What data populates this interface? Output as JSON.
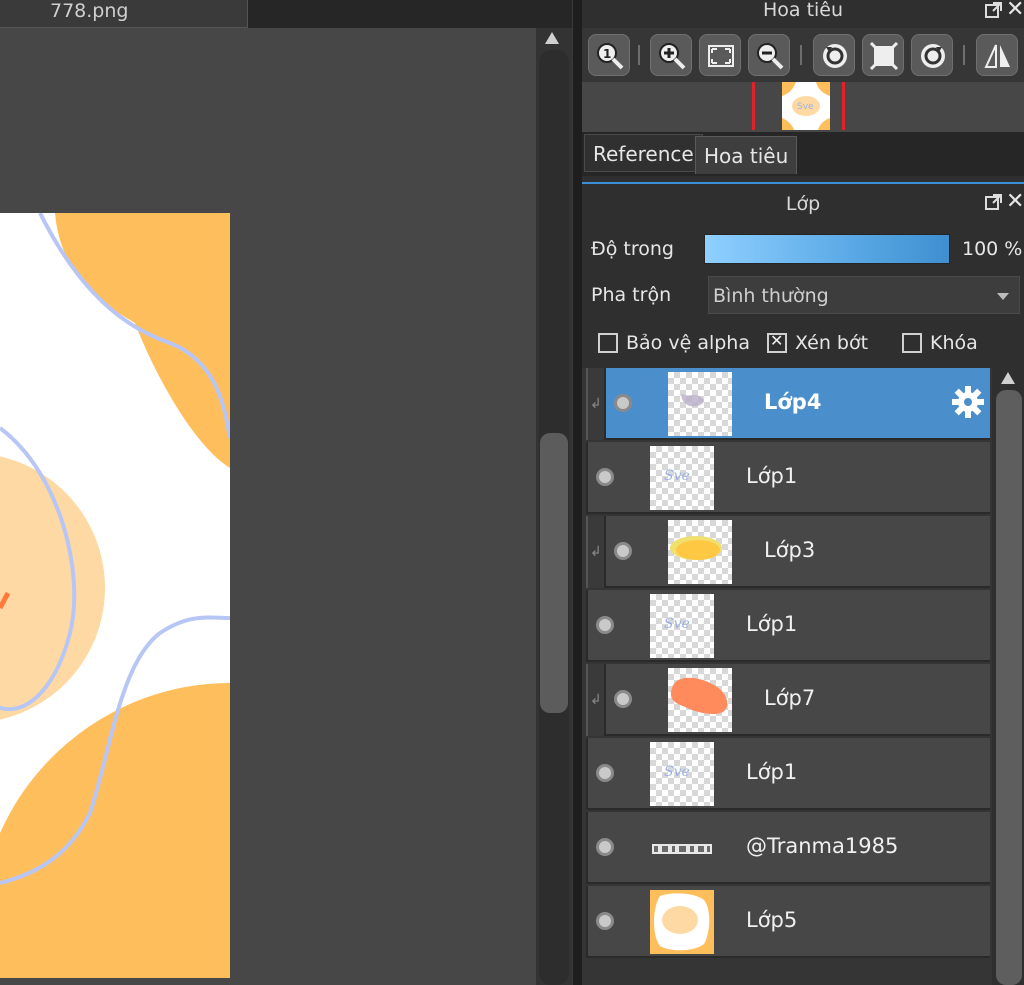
{
  "document_tab": {
    "filename": "778.png"
  },
  "navigator": {
    "title": "Hoa tiêu",
    "toolbar": [
      {
        "icon": "zoom-actual-size-icon"
      },
      {
        "icon": "zoom-in-icon"
      },
      {
        "icon": "fit-to-window-icon"
      },
      {
        "icon": "zoom-out-icon"
      },
      {
        "icon": "rotate-left-icon"
      },
      {
        "icon": "reset-view-icon"
      },
      {
        "icon": "rotate-right-icon"
      },
      {
        "icon": "flip-horizontal-icon"
      }
    ],
    "tabs": [
      {
        "label": "Reference",
        "active": false
      },
      {
        "label": "Hoa tiêu",
        "active": true
      }
    ]
  },
  "layers_panel": {
    "title": "Lớp",
    "opacity": {
      "label": "Độ trong",
      "value": "100 %",
      "fraction": 1.0
    },
    "blend": {
      "label": "Pha trộn",
      "value": "Bình thường"
    },
    "checkboxes": [
      {
        "label": "Bảo vệ alpha",
        "checked": false
      },
      {
        "label": "Xén bớt",
        "checked": true
      },
      {
        "label": "Khóa",
        "checked": false
      }
    ],
    "layers": [
      {
        "name": "Lớp4",
        "selected": true,
        "clipped": true,
        "thumb": "purple-scribble"
      },
      {
        "name": "Lớp1",
        "selected": false,
        "clipped": false,
        "thumb": "blue-text"
      },
      {
        "name": "Lớp3",
        "selected": false,
        "clipped": true,
        "thumb": "yellow-blob"
      },
      {
        "name": "Lớp1",
        "selected": false,
        "clipped": false,
        "thumb": "blue-text"
      },
      {
        "name": "Lớp7",
        "selected": false,
        "clipped": true,
        "thumb": "orange-blob"
      },
      {
        "name": "Lớp1",
        "selected": false,
        "clipped": false,
        "thumb": "blue-text"
      },
      {
        "name": "@Tranma1985",
        "selected": false,
        "clipped": false,
        "thumb": "text-strip"
      },
      {
        "name": "Lớp5",
        "selected": false,
        "clipped": false,
        "thumb": "orange-artwork"
      }
    ]
  },
  "colors": {
    "accent": "#4a8fcc",
    "artwork_orange": "#ffbe5c",
    "artwork_peach": "#ffd9a3",
    "artwork_line": "#b7c6f5"
  }
}
